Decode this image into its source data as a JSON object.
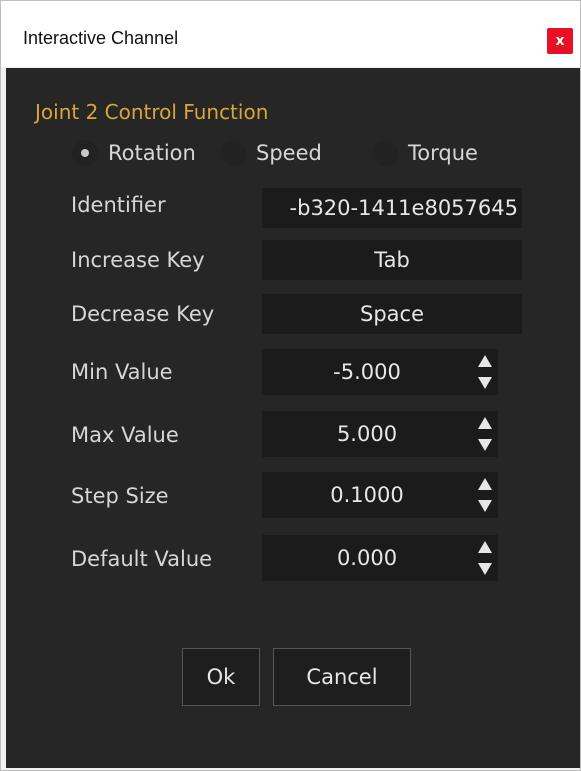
{
  "window": {
    "title": "Interactive Channel",
    "close_label": "x"
  },
  "section_title": "Joint 2 Control Function",
  "radios": [
    {
      "label": "Rotation",
      "checked": true
    },
    {
      "label": "Speed",
      "checked": false
    },
    {
      "label": "Torque",
      "checked": false
    }
  ],
  "fields": {
    "identifier": {
      "label": "Identifier",
      "value": "-b320-1411e8057645"
    },
    "increase_key": {
      "label": "Increase Key",
      "value": "Tab"
    },
    "decrease_key": {
      "label": "Decrease Key",
      "value": "Space"
    }
  },
  "spinners": {
    "min_value": {
      "label": "Min Value",
      "value": "-5.000"
    },
    "max_value": {
      "label": "Max Value",
      "value": "5.000"
    },
    "step_size": {
      "label": "Step Size",
      "value": "0.1000"
    },
    "default_value": {
      "label": "Default Value",
      "value": "0.000"
    }
  },
  "buttons": {
    "ok": "Ok",
    "cancel": "Cancel"
  },
  "colors": {
    "accent": "#d9a43a",
    "background": "#262626",
    "field": "#1b1b1b",
    "close": "#e81123"
  },
  "icons": {
    "close": "close-icon",
    "spin_up": "arrow-up-icon",
    "spin_down": "arrow-down-icon"
  }
}
